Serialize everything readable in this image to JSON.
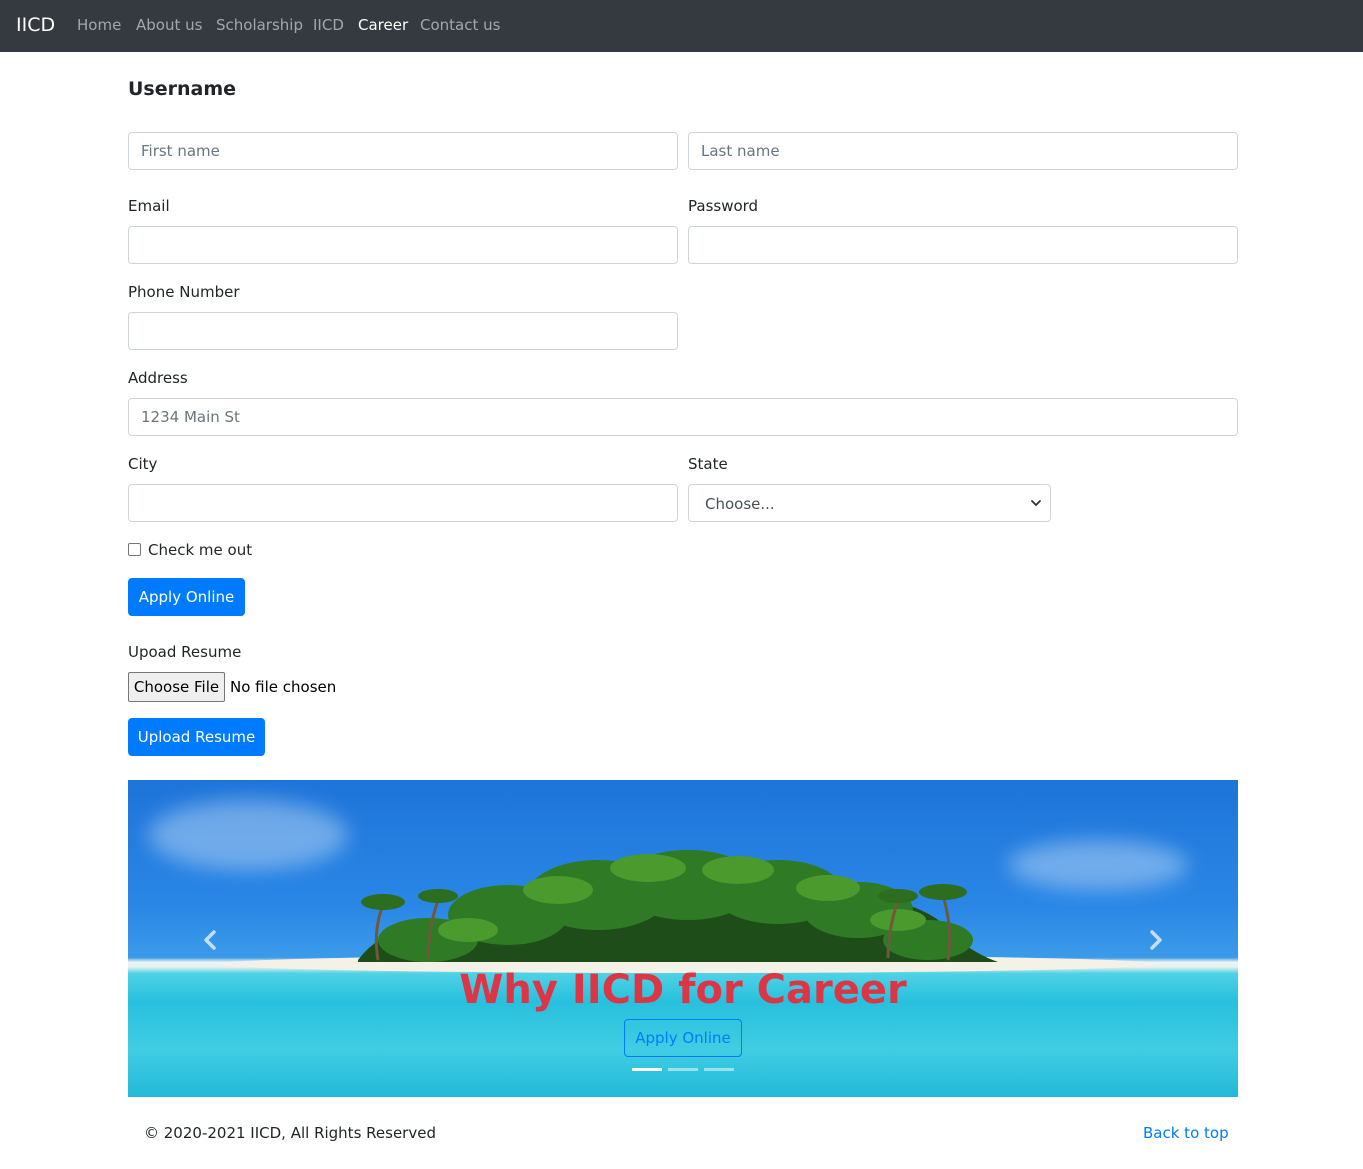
{
  "navbar": {
    "brand": "IICD",
    "links": [
      {
        "label": "Home",
        "active": false
      },
      {
        "label": "About us",
        "active": false
      },
      {
        "label": "Scholarship",
        "active": false
      },
      {
        "label": "IICD",
        "active": false
      },
      {
        "label": "Career",
        "active": true
      },
      {
        "label": "Contact us",
        "active": false
      }
    ]
  },
  "form": {
    "heading": "Username",
    "first_name": {
      "placeholder": "First name",
      "value": ""
    },
    "last_name": {
      "placeholder": "Last name",
      "value": ""
    },
    "email": {
      "label": "Email",
      "value": ""
    },
    "password": {
      "label": "Password",
      "value": ""
    },
    "phone": {
      "label": "Phone Number",
      "value": ""
    },
    "address": {
      "label": "Address",
      "placeholder": "1234 Main St",
      "value": ""
    },
    "city": {
      "label": "City",
      "value": ""
    },
    "state": {
      "label": "State",
      "selected": "Choose..."
    },
    "check": {
      "label": "Check me out",
      "checked": false
    },
    "apply_button": "Apply Online",
    "resume": {
      "label": "Upoad Resume",
      "choose_file": "Choose File",
      "status": "No file chosen",
      "upload_button": "Upload Resume"
    }
  },
  "carousel": {
    "caption": "Why IICD for Career",
    "button": "Apply Online",
    "slide_count": 3,
    "active_index": 0
  },
  "footer": {
    "copyright": "© 2020-2021 IICD, All Rights Reserved",
    "back_to_top": "Back to top"
  },
  "colors": {
    "navbar_bg": "#343a40",
    "primary": "#007bff",
    "caption": "#dc3545"
  }
}
